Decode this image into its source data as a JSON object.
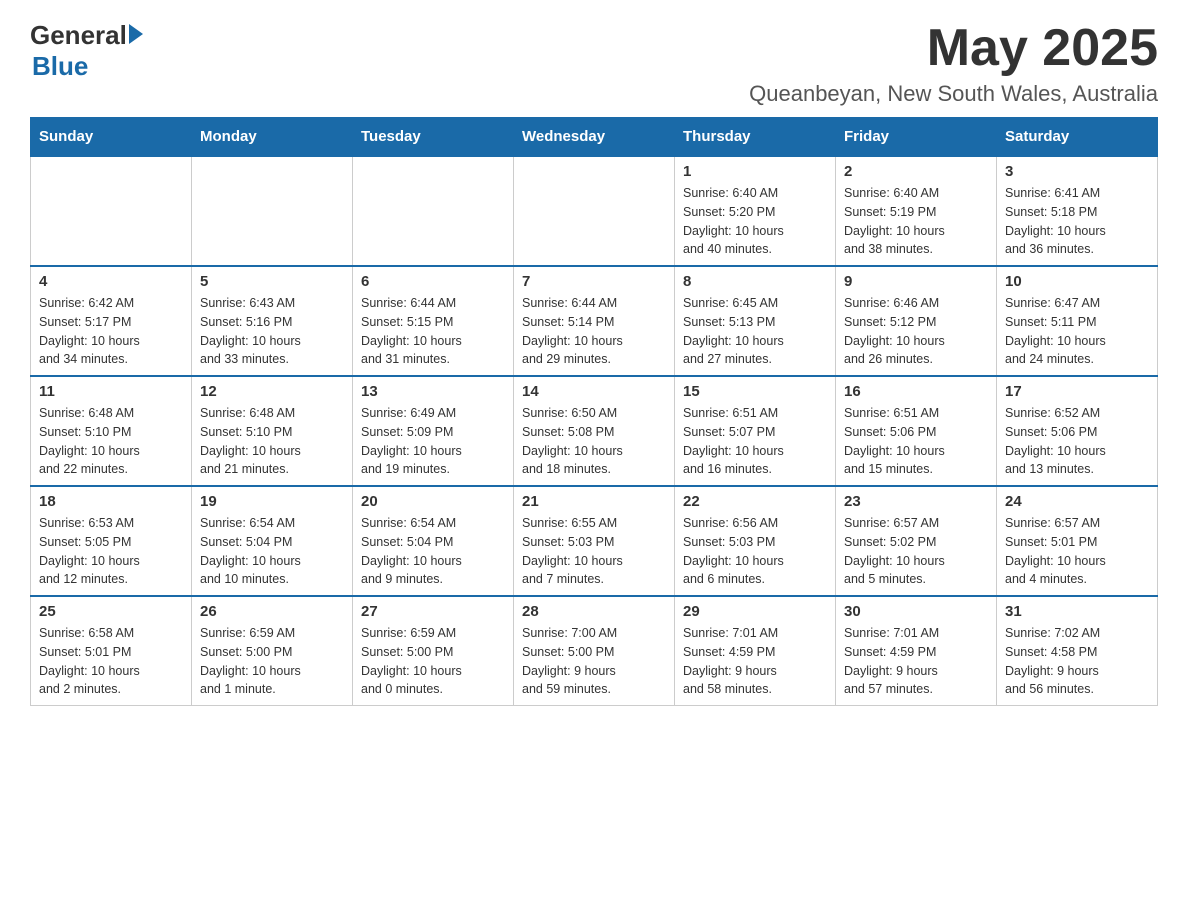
{
  "logo": {
    "general": "General",
    "blue": "Blue"
  },
  "header": {
    "month": "May 2025",
    "location": "Queanbeyan, New South Wales, Australia"
  },
  "weekdays": [
    "Sunday",
    "Monday",
    "Tuesday",
    "Wednesday",
    "Thursday",
    "Friday",
    "Saturday"
  ],
  "weeks": [
    [
      {
        "day": "",
        "info": ""
      },
      {
        "day": "",
        "info": ""
      },
      {
        "day": "",
        "info": ""
      },
      {
        "day": "",
        "info": ""
      },
      {
        "day": "1",
        "info": "Sunrise: 6:40 AM\nSunset: 5:20 PM\nDaylight: 10 hours\nand 40 minutes."
      },
      {
        "day": "2",
        "info": "Sunrise: 6:40 AM\nSunset: 5:19 PM\nDaylight: 10 hours\nand 38 minutes."
      },
      {
        "day": "3",
        "info": "Sunrise: 6:41 AM\nSunset: 5:18 PM\nDaylight: 10 hours\nand 36 minutes."
      }
    ],
    [
      {
        "day": "4",
        "info": "Sunrise: 6:42 AM\nSunset: 5:17 PM\nDaylight: 10 hours\nand 34 minutes."
      },
      {
        "day": "5",
        "info": "Sunrise: 6:43 AM\nSunset: 5:16 PM\nDaylight: 10 hours\nand 33 minutes."
      },
      {
        "day": "6",
        "info": "Sunrise: 6:44 AM\nSunset: 5:15 PM\nDaylight: 10 hours\nand 31 minutes."
      },
      {
        "day": "7",
        "info": "Sunrise: 6:44 AM\nSunset: 5:14 PM\nDaylight: 10 hours\nand 29 minutes."
      },
      {
        "day": "8",
        "info": "Sunrise: 6:45 AM\nSunset: 5:13 PM\nDaylight: 10 hours\nand 27 minutes."
      },
      {
        "day": "9",
        "info": "Sunrise: 6:46 AM\nSunset: 5:12 PM\nDaylight: 10 hours\nand 26 minutes."
      },
      {
        "day": "10",
        "info": "Sunrise: 6:47 AM\nSunset: 5:11 PM\nDaylight: 10 hours\nand 24 minutes."
      }
    ],
    [
      {
        "day": "11",
        "info": "Sunrise: 6:48 AM\nSunset: 5:10 PM\nDaylight: 10 hours\nand 22 minutes."
      },
      {
        "day": "12",
        "info": "Sunrise: 6:48 AM\nSunset: 5:10 PM\nDaylight: 10 hours\nand 21 minutes."
      },
      {
        "day": "13",
        "info": "Sunrise: 6:49 AM\nSunset: 5:09 PM\nDaylight: 10 hours\nand 19 minutes."
      },
      {
        "day": "14",
        "info": "Sunrise: 6:50 AM\nSunset: 5:08 PM\nDaylight: 10 hours\nand 18 minutes."
      },
      {
        "day": "15",
        "info": "Sunrise: 6:51 AM\nSunset: 5:07 PM\nDaylight: 10 hours\nand 16 minutes."
      },
      {
        "day": "16",
        "info": "Sunrise: 6:51 AM\nSunset: 5:06 PM\nDaylight: 10 hours\nand 15 minutes."
      },
      {
        "day": "17",
        "info": "Sunrise: 6:52 AM\nSunset: 5:06 PM\nDaylight: 10 hours\nand 13 minutes."
      }
    ],
    [
      {
        "day": "18",
        "info": "Sunrise: 6:53 AM\nSunset: 5:05 PM\nDaylight: 10 hours\nand 12 minutes."
      },
      {
        "day": "19",
        "info": "Sunrise: 6:54 AM\nSunset: 5:04 PM\nDaylight: 10 hours\nand 10 minutes."
      },
      {
        "day": "20",
        "info": "Sunrise: 6:54 AM\nSunset: 5:04 PM\nDaylight: 10 hours\nand 9 minutes."
      },
      {
        "day": "21",
        "info": "Sunrise: 6:55 AM\nSunset: 5:03 PM\nDaylight: 10 hours\nand 7 minutes."
      },
      {
        "day": "22",
        "info": "Sunrise: 6:56 AM\nSunset: 5:03 PM\nDaylight: 10 hours\nand 6 minutes."
      },
      {
        "day": "23",
        "info": "Sunrise: 6:57 AM\nSunset: 5:02 PM\nDaylight: 10 hours\nand 5 minutes."
      },
      {
        "day": "24",
        "info": "Sunrise: 6:57 AM\nSunset: 5:01 PM\nDaylight: 10 hours\nand 4 minutes."
      }
    ],
    [
      {
        "day": "25",
        "info": "Sunrise: 6:58 AM\nSunset: 5:01 PM\nDaylight: 10 hours\nand 2 minutes."
      },
      {
        "day": "26",
        "info": "Sunrise: 6:59 AM\nSunset: 5:00 PM\nDaylight: 10 hours\nand 1 minute."
      },
      {
        "day": "27",
        "info": "Sunrise: 6:59 AM\nSunset: 5:00 PM\nDaylight: 10 hours\nand 0 minutes."
      },
      {
        "day": "28",
        "info": "Sunrise: 7:00 AM\nSunset: 5:00 PM\nDaylight: 9 hours\nand 59 minutes."
      },
      {
        "day": "29",
        "info": "Sunrise: 7:01 AM\nSunset: 4:59 PM\nDaylight: 9 hours\nand 58 minutes."
      },
      {
        "day": "30",
        "info": "Sunrise: 7:01 AM\nSunset: 4:59 PM\nDaylight: 9 hours\nand 57 minutes."
      },
      {
        "day": "31",
        "info": "Sunrise: 7:02 AM\nSunset: 4:58 PM\nDaylight: 9 hours\nand 56 minutes."
      }
    ]
  ]
}
